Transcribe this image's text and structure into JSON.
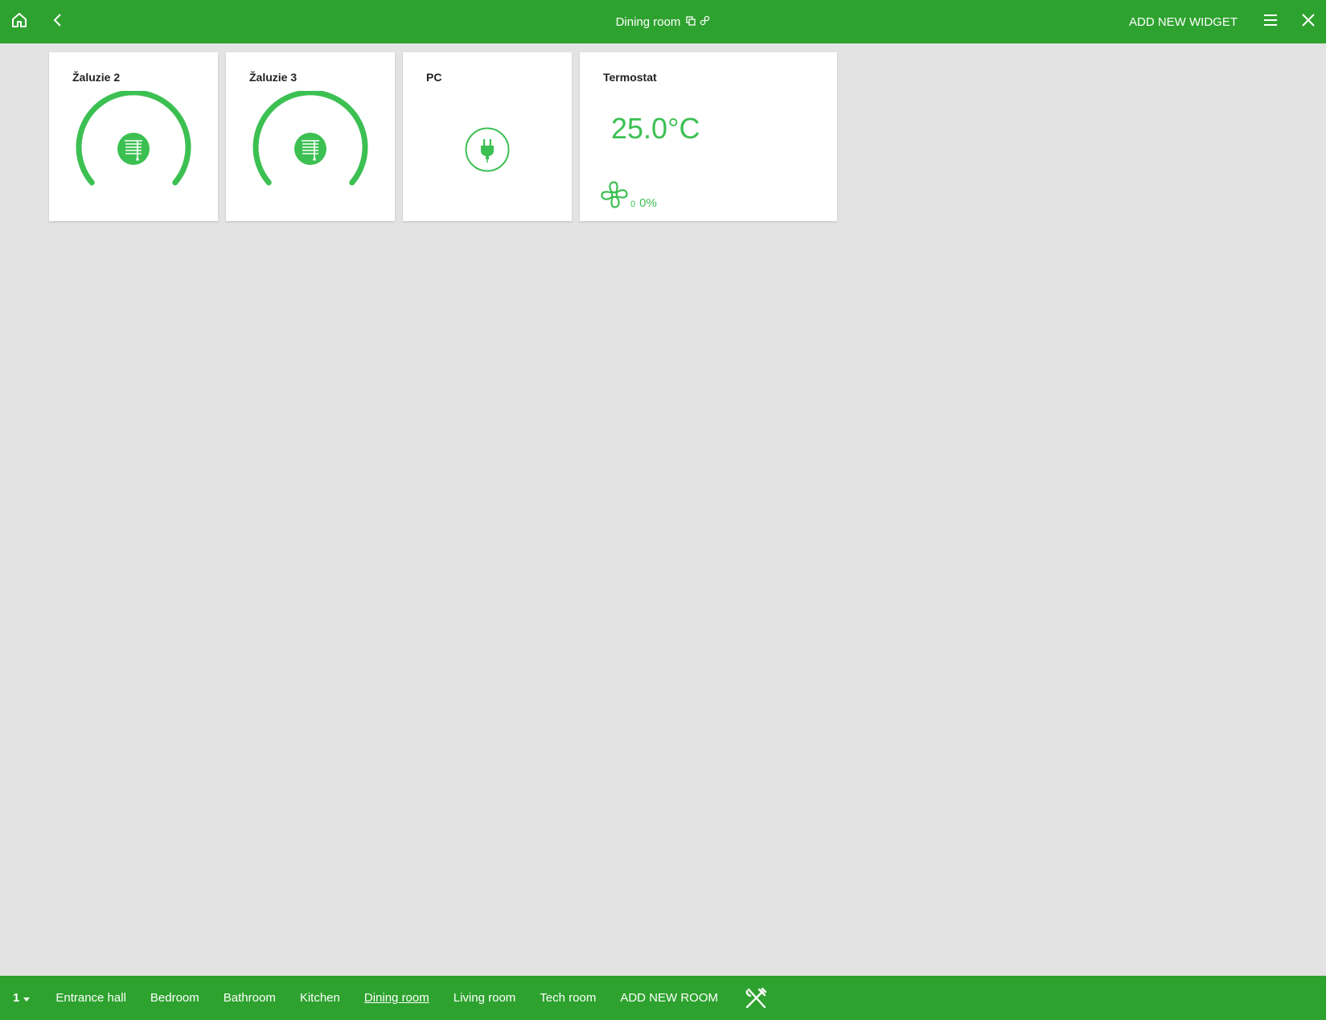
{
  "header": {
    "title": "Dining room",
    "add_widget_label": "ADD NEW WIDGET",
    "icons": [
      "home-icon",
      "back-icon",
      "copy-icon",
      "link-icon",
      "menu-icon",
      "close-icon"
    ]
  },
  "widgets": [
    {
      "title": "Žaluzie 2",
      "type": "blinds",
      "icon": "blinds-icon"
    },
    {
      "title": "Žaluzie 3",
      "type": "blinds",
      "icon": "blinds-icon"
    },
    {
      "title": "PC",
      "type": "socket",
      "icon": "plug-icon"
    },
    {
      "title": "Termostat",
      "type": "thermostat",
      "temperature": "25.0°C",
      "fan_level": "0",
      "fan_percent": "0%",
      "icon": "fan-icon"
    }
  ],
  "footer": {
    "floor": "1",
    "rooms": [
      "Entrance hall",
      "Bedroom",
      "Bathroom",
      "Kitchen",
      "Dining room",
      "Living room",
      "Tech room"
    ],
    "active_room": "Dining room",
    "add_room_label": "ADD NEW ROOM",
    "room_icon": "fork-knife-icon"
  },
  "colors": {
    "bar": "#2ea22f",
    "accent": "#3cc052",
    "background": "#e3e3e3"
  }
}
